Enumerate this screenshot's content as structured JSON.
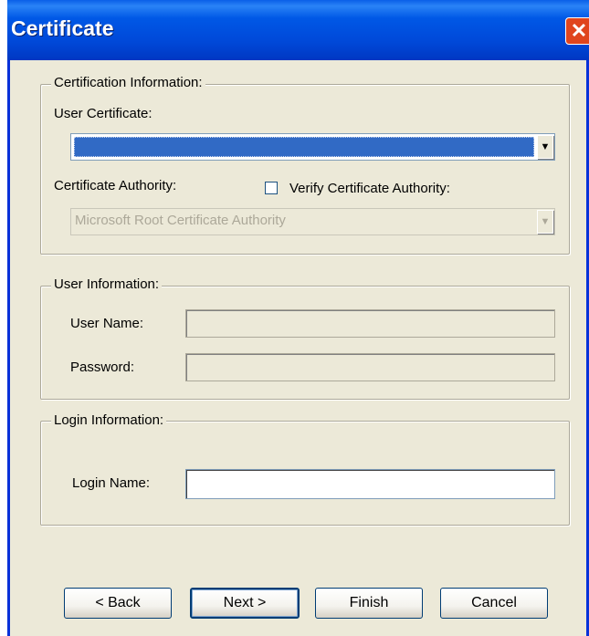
{
  "window": {
    "title": "Certificate",
    "close_glyph": "✕"
  },
  "cert_group": {
    "legend": "Certification Information:",
    "user_certificate_label": "User Certificate:",
    "user_certificate_value": "",
    "authority_label": "Certificate Authority:",
    "verify_label": "Verify Certificate Authority:",
    "verify_checked": false,
    "authority_value": "Microsoft Root Certificate Authority"
  },
  "user_group": {
    "legend": "User Information:",
    "username_label": "User Name:",
    "username_value": "",
    "password_label": "Password:",
    "password_value": ""
  },
  "login_group": {
    "legend": "Login Information:",
    "login_name_label": "Login Name:",
    "login_name_value": ""
  },
  "buttons": {
    "back": "< Back",
    "next": "Next >",
    "finish": "Finish",
    "cancel": "Cancel"
  },
  "icons": {
    "dropdown": "▼"
  },
  "colors": {
    "titlebar": "#0058e6",
    "dialog_bg": "#ece9d8",
    "selection": "#316ac5",
    "close": "#e0451e"
  }
}
